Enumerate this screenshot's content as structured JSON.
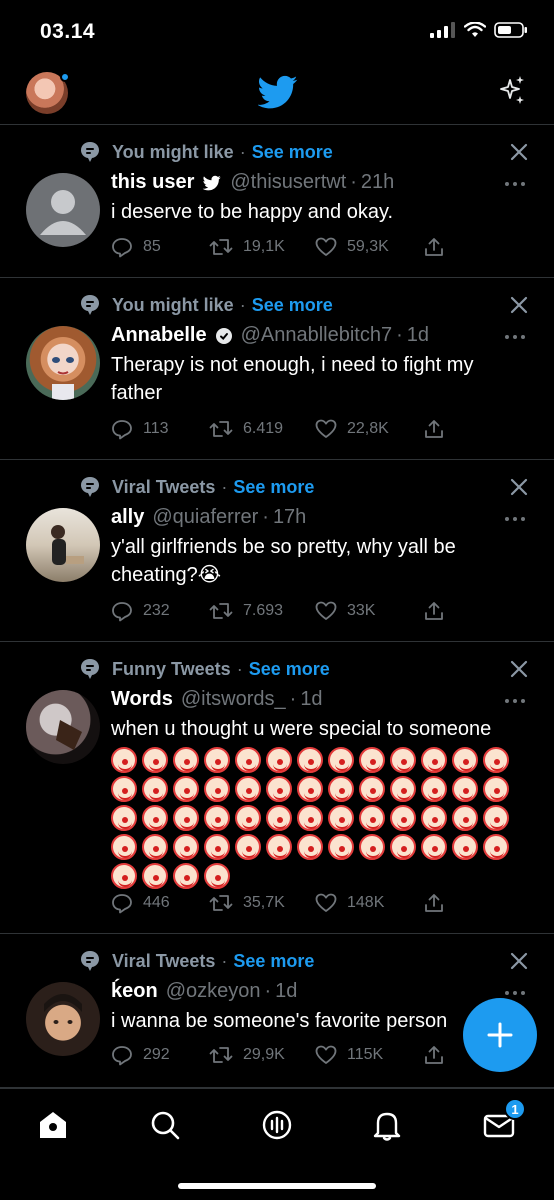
{
  "status_bar": {
    "time": "03.14"
  },
  "feed": {
    "tweets": [
      {
        "context": "You might like",
        "see_more": "See more",
        "name": "this user",
        "badge": "bird-badge",
        "handle": "@thisusertwt",
        "time": "21h",
        "text": "i deserve to be happy and okay.",
        "replies": "85",
        "retweets": "19,1K",
        "likes": "59,3K"
      },
      {
        "context": "You might like",
        "see_more": "See more",
        "name": "Annabelle",
        "badge": "circle-badge",
        "handle": "@Annabllebitch7",
        "time": "1d",
        "text": "Therapy is not enough, i need to fight my father",
        "replies": "113",
        "retweets": "6.419",
        "likes": "22,8K"
      },
      {
        "context": "Viral Tweets",
        "see_more": "See more",
        "name": "ally",
        "handle": "@quiaferrer",
        "time": "17h",
        "text": "y'all girlfriends be so pretty, why yall be cheating?😭",
        "replies": "232",
        "retweets": "7.693",
        "likes": "33K"
      },
      {
        "context": "Funny Tweets",
        "see_more": "See more",
        "name": "Words",
        "handle": "@itswords_",
        "time": "1d",
        "text": "when u thought u were special to someone",
        "emoji": "clown-face",
        "emoji_count": 56,
        "replies": "446",
        "retweets": "35,7K",
        "likes": "148K"
      },
      {
        "context": "Viral Tweets",
        "see_more": "See more",
        "name": "ḱeon",
        "handle": "@ozkeyon",
        "time": "1d",
        "text": "i wanna be someone's favorite person",
        "replies": "292",
        "retweets": "29,9K",
        "likes": "115K"
      }
    ]
  },
  "tab_bar": {
    "messages_badge": "1"
  },
  "colors": {
    "accent": "#1d9bf0",
    "background": "#000000",
    "muted": "#71767b",
    "divider": "#2f3336"
  }
}
